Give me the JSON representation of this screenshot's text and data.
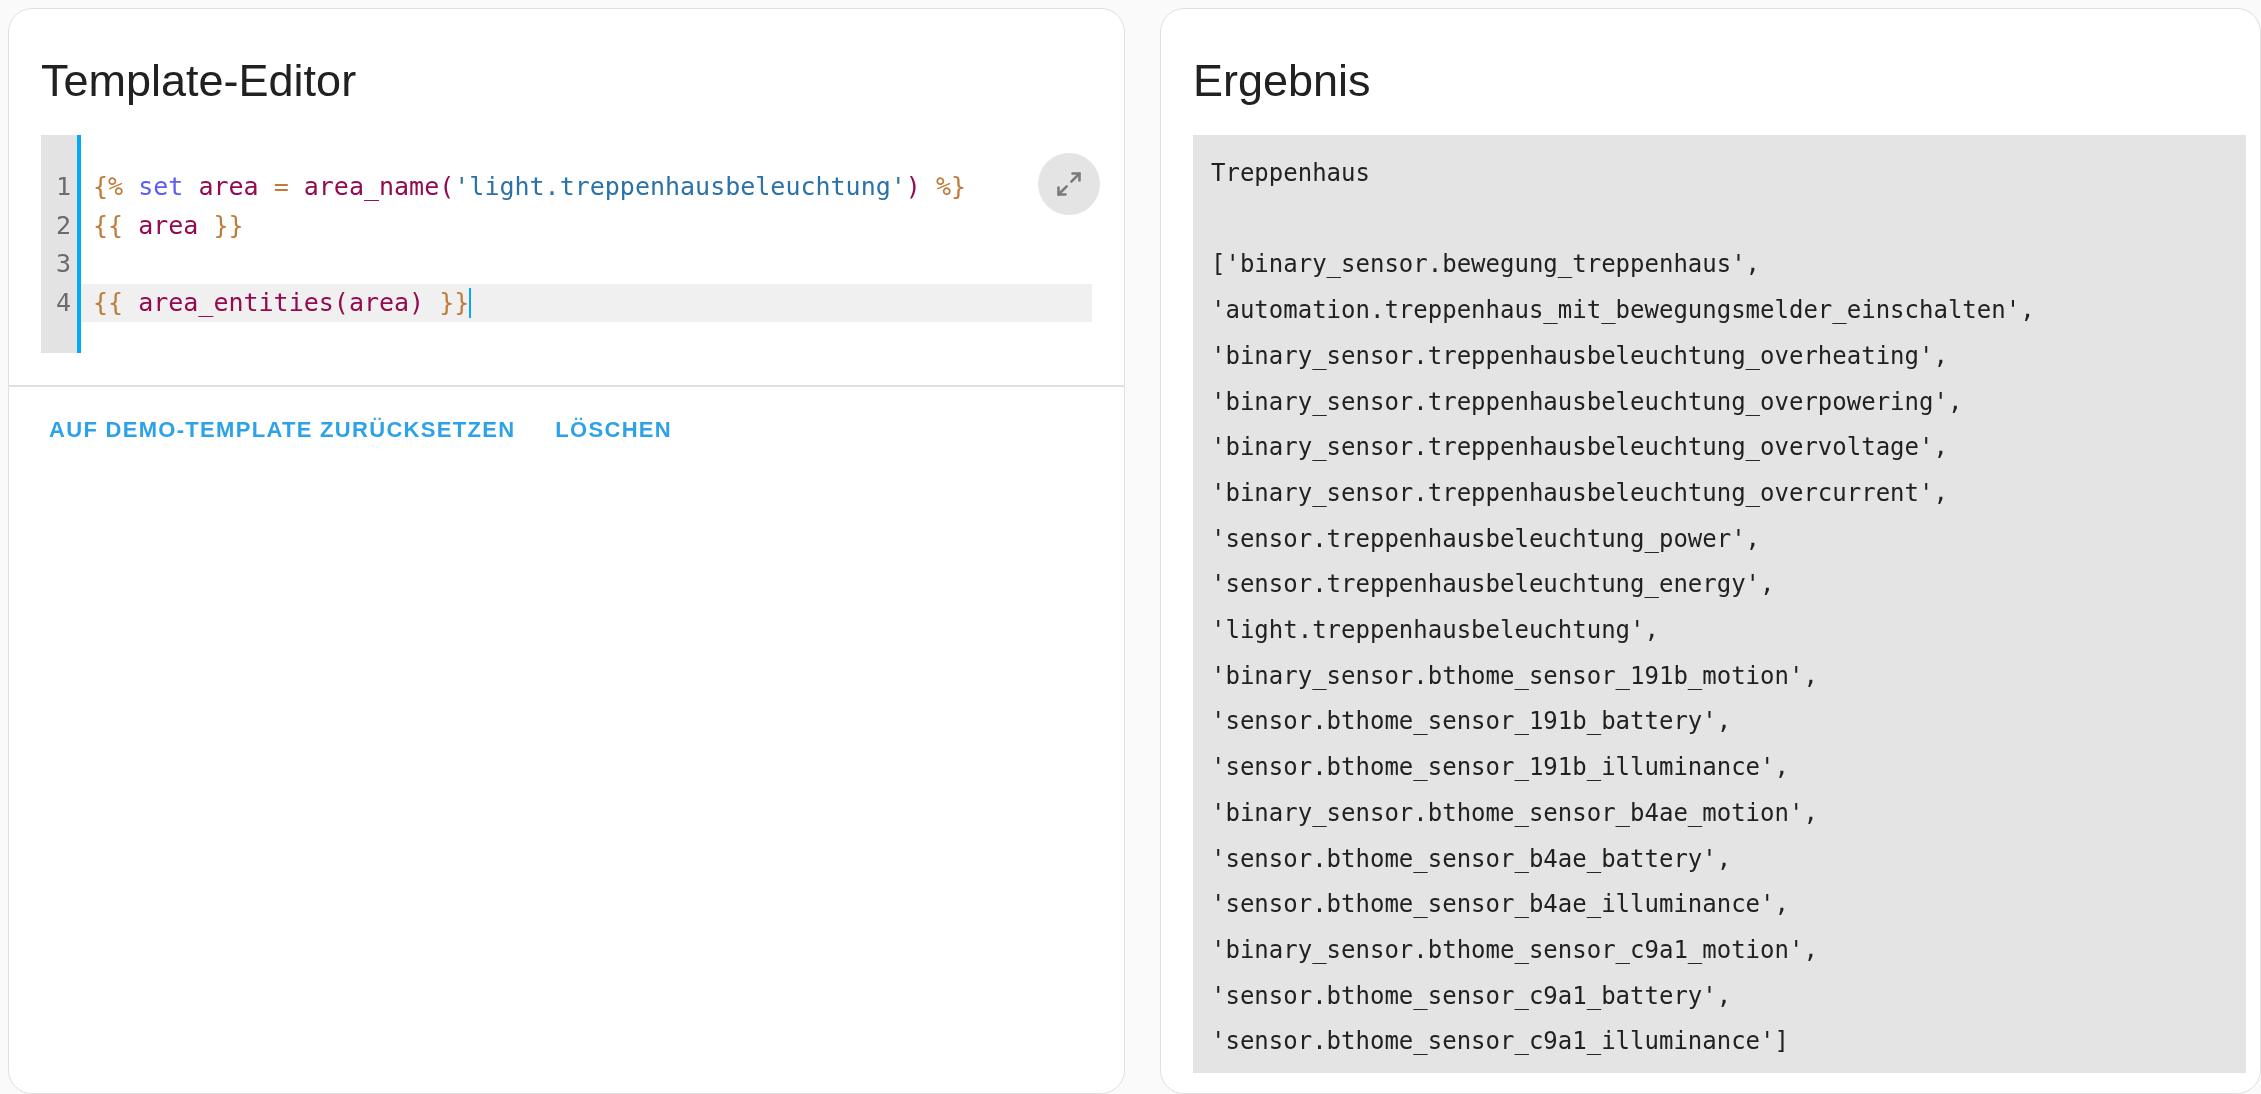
{
  "editor_card": {
    "title": "Template-Editor",
    "lines": [
      {
        "number": "1",
        "active": false,
        "tokens": [
          {
            "text": "{%",
            "kind": "delim"
          },
          {
            "text": " set",
            "kind": "keyword"
          },
          {
            "text": " area",
            "kind": "var"
          },
          {
            "text": " =",
            "kind": "delim"
          },
          {
            "text": " area_name(",
            "kind": "var"
          },
          {
            "text": "'light.treppenhausbeleuchtung'",
            "kind": "string"
          },
          {
            "text": ")",
            "kind": "var"
          },
          {
            "text": " %}",
            "kind": "delim"
          }
        ]
      },
      {
        "number": "2",
        "active": false,
        "tokens": [
          {
            "text": "{{",
            "kind": "delim"
          },
          {
            "text": " area",
            "kind": "var"
          },
          {
            "text": " }}",
            "kind": "delim"
          }
        ]
      },
      {
        "number": "3",
        "active": false
      },
      {
        "number": "4",
        "active": true,
        "tokens": [
          {
            "text": "{{",
            "kind": "delim"
          },
          {
            "text": " area_entities(area)",
            "kind": "var"
          },
          {
            "text": " }}",
            "kind": "delim"
          }
        ]
      }
    ],
    "actions": [
      "AUF DEMO-TEMPLATE ZURÜCKSETZEN",
      "LÖSCHEN"
    ]
  },
  "result_card": {
    "title": "Ergebnis",
    "value": "Treppenhaus",
    "entities": [
      "['binary_sensor.bewegung_treppenhaus',",
      "'automation.treppenhaus_mit_bewegungsmelder_einschalten',",
      "'binary_sensor.treppenhausbeleuchtung_overheating',",
      "'binary_sensor.treppenhausbeleuchtung_overpowering',",
      "'binary_sensor.treppenhausbeleuchtung_overvoltage',",
      "'binary_sensor.treppenhausbeleuchtung_overcurrent',",
      "'sensor.treppenhausbeleuchtung_power',",
      "'sensor.treppenhausbeleuchtung_energy',",
      "'light.treppenhausbeleuchtung',",
      "'binary_sensor.bthome_sensor_191b_motion',",
      "'sensor.bthome_sensor_191b_battery',",
      "'sensor.bthome_sensor_191b_illuminance',",
      "'binary_sensor.bthome_sensor_b4ae_motion',",
      "'sensor.bthome_sensor_b4ae_battery',",
      "'sensor.bthome_sensor_b4ae_illuminance',",
      "'binary_sensor.bthome_sensor_c9a1_motion',",
      "'sensor.bthome_sensor_c9a1_battery',",
      "'sensor.bthome_sensor_c9a1_illuminance']"
    ]
  }
}
